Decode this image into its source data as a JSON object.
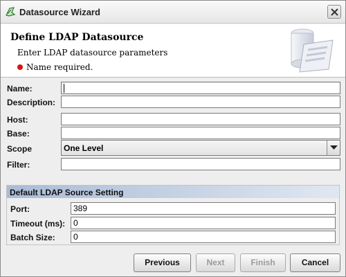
{
  "window": {
    "title": "Datasource Wizard"
  },
  "header": {
    "title": "Define LDAP Datasource",
    "subtitle": "Enter LDAP datasource parameters",
    "error": "Name required."
  },
  "form": {
    "name": {
      "label": "Name:",
      "value": ""
    },
    "description": {
      "label": "Description:",
      "value": ""
    },
    "host": {
      "label": "Host:",
      "value": ""
    },
    "base": {
      "label": "Base:",
      "value": ""
    },
    "scope": {
      "label": "Scope",
      "selected": "One Level"
    },
    "filter": {
      "label": "Filter:",
      "value": ""
    }
  },
  "source_settings": {
    "title": "Default LDAP Source Setting",
    "port": {
      "label": "Port:",
      "value": "389"
    },
    "timeout": {
      "label": "Timeout (ms):",
      "value": "0"
    },
    "batch_size": {
      "label": "Batch Size:",
      "value": "0"
    }
  },
  "buttons": {
    "previous": "Previous",
    "next": "Next",
    "finish": "Finish",
    "cancel": "Cancel"
  },
  "colors": {
    "error_dot": "#dd1111",
    "section_header": "#a9bcd6"
  }
}
